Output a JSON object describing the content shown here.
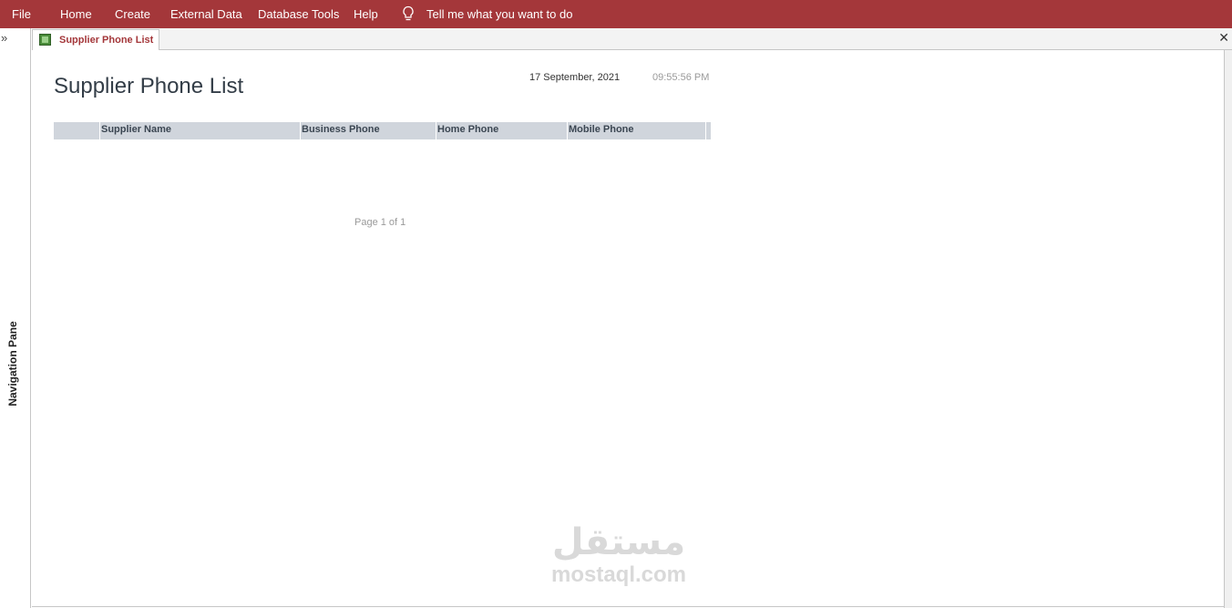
{
  "menu": {
    "file": "File",
    "home": "Home",
    "create": "Create",
    "external_data": "External Data",
    "database_tools": "Database Tools",
    "help": "Help",
    "tell_me": "Tell me what you want to do"
  },
  "nav_pane": {
    "expand_glyph": "»",
    "label": "Navigation Pane"
  },
  "document_tab": {
    "label": "Supplier Phone List",
    "close_glyph": "✕"
  },
  "report": {
    "title": "Supplier Phone List",
    "date": "17 September, 2021",
    "time": "09:55:56 PM",
    "columns": [
      "Supplier Name",
      "Business Phone",
      "Home Phone",
      "Mobile Phone"
    ],
    "page_footer": "Page 1 of 1"
  },
  "watermark": {
    "arabic": "مستقل",
    "latin": "mostaql.com"
  },
  "colors": {
    "ribbon": "#a4373a",
    "header_band": "#d0d5dc",
    "title_text": "#333d47"
  }
}
